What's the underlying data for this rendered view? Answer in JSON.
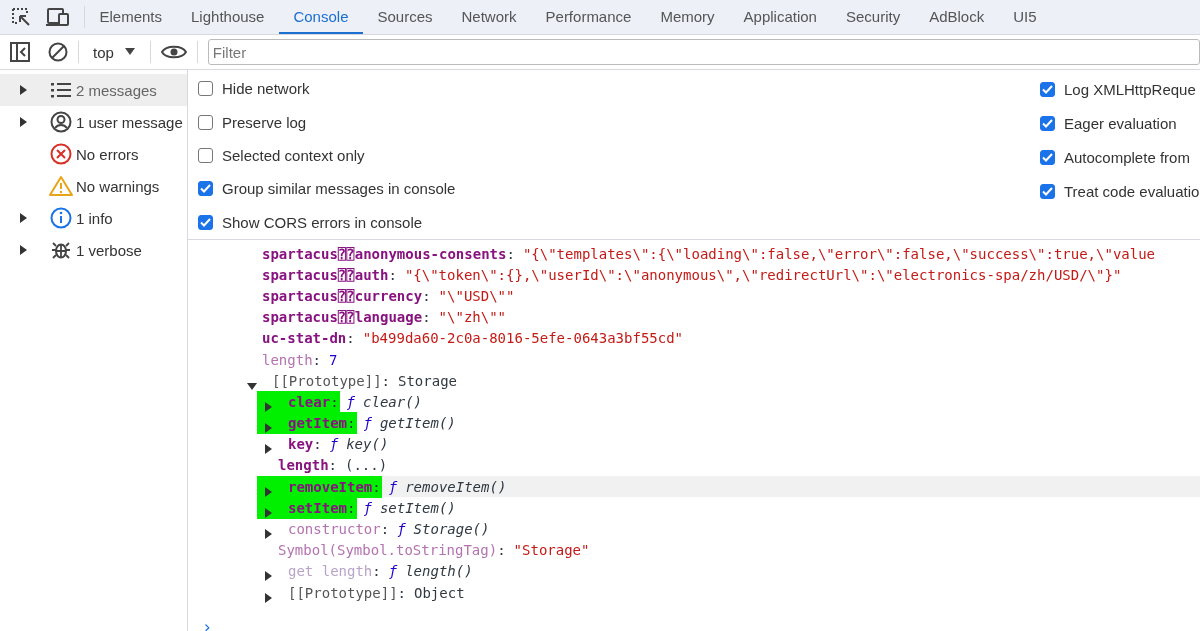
{
  "tabs": [
    {
      "label": "Elements",
      "selected": false
    },
    {
      "label": "Lighthouse",
      "selected": false
    },
    {
      "label": "Console",
      "selected": true
    },
    {
      "label": "Sources",
      "selected": false
    },
    {
      "label": "Network",
      "selected": false
    },
    {
      "label": "Performance",
      "selected": false
    },
    {
      "label": "Memory",
      "selected": false
    },
    {
      "label": "Application",
      "selected": false
    },
    {
      "label": "Security",
      "selected": false
    },
    {
      "label": "AdBlock",
      "selected": false
    },
    {
      "label": "UI5",
      "selected": false
    }
  ],
  "toolbar": {
    "context": "top",
    "filter_placeholder": "Filter"
  },
  "sidebar": {
    "items": [
      {
        "kind": "list",
        "label": "2 messages",
        "expanded": false,
        "selected": true
      },
      {
        "kind": "user",
        "label": "1 user message",
        "expanded": false,
        "selected": false
      },
      {
        "kind": "error",
        "label": "No errors",
        "selected": false
      },
      {
        "kind": "warning",
        "label": "No warnings",
        "selected": false
      },
      {
        "kind": "info",
        "label": "1 info",
        "expanded": false,
        "selected": false
      },
      {
        "kind": "verbose",
        "label": "1 verbose",
        "expanded": false,
        "selected": false
      }
    ]
  },
  "settings": {
    "left": [
      {
        "label": "Hide network",
        "checked": false
      },
      {
        "label": "Preserve log",
        "checked": false
      },
      {
        "label": "Selected context only",
        "checked": false
      },
      {
        "label": "Group similar messages in console",
        "checked": true
      },
      {
        "label": "Show CORS errors in console",
        "checked": true
      }
    ],
    "right": [
      {
        "label": "Log XMLHttpReque",
        "checked": true
      },
      {
        "label": "Eager evaluation",
        "checked": true
      },
      {
        "label": "Autocomplete from",
        "checked": true
      },
      {
        "label": "Treat code evaluatio",
        "checked": true
      }
    ]
  },
  "console": {
    "rows": [
      {
        "key": {
          "text": "spartacus⍰⍰anonymous-consents",
          "kind": "own"
        },
        "separator": ":",
        "value": {
          "text": "\"{\\\"templates\\\":{\\\"loading\\\":false,\\\"error\\\":false,\\\"success\\\":true,\\\"value",
          "kind": "string"
        },
        "highlighted": false,
        "hovered": false
      },
      {
        "key": {
          "text": "spartacus⍰⍰auth",
          "kind": "own"
        },
        "separator": ":",
        "value": {
          "text": "\"{\\\"token\\\":{},\\\"userId\\\":\\\"anonymous\\\",\\\"redirectUrl\\\":\\\"electronics-spa/zh/USD/\\\"}\"",
          "kind": "string"
        },
        "highlighted": false,
        "hovered": false
      },
      {
        "key": {
          "text": "spartacus⍰⍰currency",
          "kind": "own"
        },
        "separator": ":",
        "value": {
          "text": "\"\\\"USD\\\"\"",
          "kind": "string"
        },
        "highlighted": false,
        "hovered": false
      },
      {
        "key": {
          "text": "spartacus⍰⍰language",
          "kind": "own"
        },
        "separator": ":",
        "value": {
          "text": "\"\\\"zh\\\"\"",
          "kind": "string"
        },
        "highlighted": false,
        "hovered": false
      },
      {
        "key": {
          "text": "uc-stat-dn",
          "kind": "own"
        },
        "separator": ":",
        "value": {
          "text": "\"b499da60-2c0a-8016-5efe-0643a3bf55cd\"",
          "kind": "string"
        },
        "highlighted": false,
        "hovered": false
      },
      {
        "key": {
          "text": "length",
          "kind": "dim"
        },
        "separator": ":",
        "value": {
          "text": "7",
          "kind": "number"
        },
        "highlighted": false,
        "hovered": false
      },
      {
        "key": {
          "text": "[[Prototype]]",
          "kind": "plain"
        },
        "separator": ":",
        "value": {
          "text": "Storage",
          "kind": "plain"
        },
        "expanded": true,
        "highlighted": false,
        "hovered": false,
        "children": [
          {
            "key": {
              "text": "clear",
              "kind": "own"
            },
            "separator": ":",
            "func_sign": "ƒ",
            "value": {
              "text": "clear()",
              "kind": "function"
            },
            "expanded": false,
            "highlighted": true,
            "hovered": false
          },
          {
            "key": {
              "text": "getItem",
              "kind": "own"
            },
            "separator": ":",
            "func_sign": "ƒ",
            "value": {
              "text": "getItem()",
              "kind": "function"
            },
            "expanded": false,
            "highlighted": true,
            "hovered": false
          },
          {
            "key": {
              "text": "key",
              "kind": "own"
            },
            "separator": ":",
            "func_sign": "ƒ",
            "value": {
              "text": "key()",
              "kind": "function"
            },
            "expanded": false,
            "highlighted": false,
            "hovered": false
          },
          {
            "key": {
              "text": "length",
              "kind": "own"
            },
            "separator": ":",
            "value": {
              "text": "(...)",
              "kind": "plain"
            },
            "highlighted": false,
            "hovered": false
          },
          {
            "key": {
              "text": "removeItem",
              "kind": "own"
            },
            "separator": ":",
            "func_sign": "ƒ",
            "value": {
              "text": "removeItem()",
              "kind": "function"
            },
            "expanded": false,
            "highlighted": true,
            "hovered": true
          },
          {
            "key": {
              "text": "setItem",
              "kind": "own"
            },
            "separator": ":",
            "func_sign": "ƒ",
            "value": {
              "text": "setItem()",
              "kind": "function"
            },
            "expanded": false,
            "highlighted": true,
            "hovered": false
          },
          {
            "key": {
              "text": "constructor",
              "kind": "dim"
            },
            "separator": ":",
            "func_sign": "ƒ",
            "value": {
              "text": "Storage()",
              "kind": "function"
            },
            "expanded": false,
            "highlighted": false,
            "hovered": false
          },
          {
            "key": {
              "text": "Symbol(Symbol.toStringTag)",
              "kind": "dim"
            },
            "separator": ":",
            "value": {
              "text": "\"Storage\"",
              "kind": "string"
            },
            "highlighted": false,
            "hovered": false
          },
          {
            "key": {
              "text": "get length",
              "kind": "getter"
            },
            "separator": ":",
            "func_sign": "ƒ",
            "value": {
              "text": "length()",
              "kind": "function"
            },
            "expanded": false,
            "highlighted": false,
            "hovered": false
          },
          {
            "key": {
              "text": "[[Prototype]]",
              "kind": "plain"
            },
            "separator": ":",
            "value": {
              "text": "Object",
              "kind": "plain"
            },
            "expanded": false,
            "highlighted": false,
            "hovered": false
          }
        ]
      }
    ],
    "prompt": "›"
  }
}
